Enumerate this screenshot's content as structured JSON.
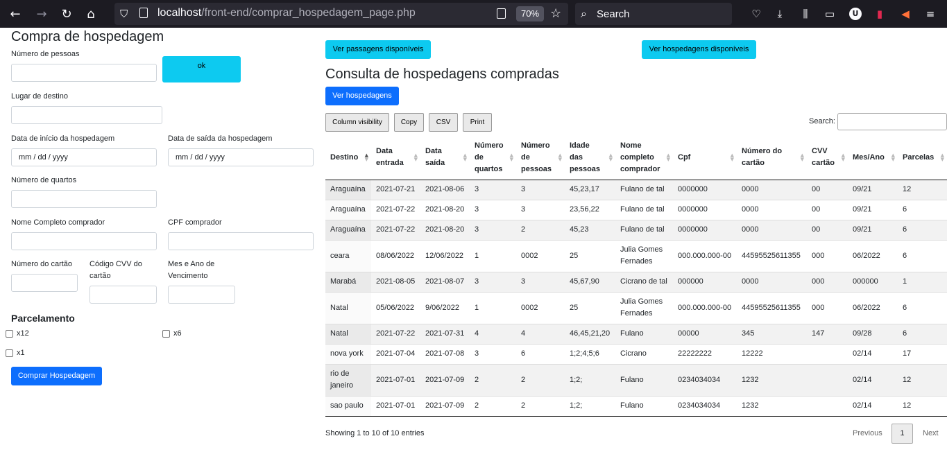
{
  "browser": {
    "url_host": "localhost",
    "url_path": "/front-end/comprar_hospedagem_page.php",
    "zoom": "70%",
    "search_placeholder": "Search",
    "avatar_letter": "U"
  },
  "form": {
    "title": "Compra de hospedagem",
    "num_pessoas_label": "Número de pessoas",
    "ok_label": "ok",
    "destino_label": "Lugar de destino",
    "data_inicio_label": "Data de início da hospedagem",
    "data_inicio_value": "mm / dd / yyyy",
    "data_saida_label": "Data de saída da hospedagem",
    "data_saida_value": "mm / dd / yyyy",
    "num_quartos_label": "Número de quartos",
    "nome_label": "Nome Completo comprador",
    "cpf_label": "CPF comprador",
    "cartao_label": "Número do cartão",
    "cvv_label_1": "Código CVV do",
    "cvv_label_2": "cartão",
    "venc_label_1": "Mes e Ano de",
    "venc_label_2": "Vencimento",
    "parcelamento_title": "Parcelamento",
    "opt_x12": "x12",
    "opt_x6": "x6",
    "opt_x1": "x1",
    "submit_label": "Comprar Hospedagem"
  },
  "right": {
    "ver_passagens": "Ver passagens disponíveis",
    "ver_hospedagens_disp": "Ver hospedagens disponíveis",
    "title": "Consulta de hospedagens compradas",
    "ver_hospedagens": "Ver hospedagens",
    "dt_buttons": [
      "Column visibility",
      "Copy",
      "CSV",
      "Print"
    ],
    "search_label": "Search:",
    "info": "Showing 1 to 10 of 10 entries",
    "prev": "Previous",
    "page": "1",
    "next": "Next"
  },
  "table": {
    "headers": [
      [
        "Destino"
      ],
      [
        "Data",
        "entrada"
      ],
      [
        "Data",
        "saída"
      ],
      [
        "Número",
        "de",
        "quartos"
      ],
      [
        "Número",
        "de",
        "pessoas"
      ],
      [
        "Idade",
        "das",
        "pessoas"
      ],
      [
        "Nome",
        "completo",
        "comprador"
      ],
      [
        "Cpf"
      ],
      [
        "Número do",
        "cartão"
      ],
      [
        "CVV",
        "cartão"
      ],
      [
        "Mes/Ano"
      ],
      [
        "Parcelas"
      ]
    ],
    "rows": [
      [
        [
          "Araguaína"
        ],
        "2021-07-21",
        "2021-08-06",
        "3",
        "3",
        "45,23,17",
        [
          "Fulano de tal"
        ],
        "0000000",
        "0000",
        "00",
        "09/21",
        "12"
      ],
      [
        [
          "Araguaína"
        ],
        "2021-07-22",
        "2021-08-20",
        "3",
        "3",
        "23,56,22",
        [
          "Fulano de tal"
        ],
        "0000000",
        "0000",
        "00",
        "09/21",
        "6"
      ],
      [
        [
          "Araguaína"
        ],
        "2021-07-22",
        "2021-08-20",
        "3",
        "2",
        "45,23",
        [
          "Fulano de tal"
        ],
        "0000000",
        "0000",
        "00",
        "09/21",
        "6"
      ],
      [
        [
          "ceara"
        ],
        "08/06/2022",
        "12/06/2022",
        "1",
        "0002",
        "25",
        [
          "Julia Gomes",
          "Fernades"
        ],
        "000.000.000-00",
        "44595525611355",
        "000",
        "06/2022",
        "6"
      ],
      [
        [
          "Marabá"
        ],
        "2021-08-05",
        "2021-08-07",
        "3",
        "3",
        "45,67,90",
        [
          "Cicrano de tal"
        ],
        "000000",
        "0000",
        "000",
        "000000",
        "1"
      ],
      [
        [
          "Natal"
        ],
        "05/06/2022",
        "9/06/2022",
        "1",
        "0002",
        "25",
        [
          "Julia Gomes",
          "Fernades"
        ],
        "000.000.000-00",
        "44595525611355",
        "000",
        "06/2022",
        "6"
      ],
      [
        [
          "Natal"
        ],
        "2021-07-22",
        "2021-07-31",
        "4",
        "4",
        "46,45,21,20",
        [
          "Fulano"
        ],
        "00000",
        "345",
        "147",
        "09/28",
        "6"
      ],
      [
        [
          "nova york"
        ],
        "2021-07-04",
        "2021-07-08",
        "3",
        "6",
        "1;2;4;5;6",
        [
          "Cicrano"
        ],
        "22222222",
        "12222",
        "",
        "02/14",
        "17"
      ],
      [
        [
          "rio de",
          "janeiro"
        ],
        "2021-07-01",
        "2021-07-09",
        "2",
        "2",
        "1;2;",
        [
          "Fulano"
        ],
        "0234034034",
        "1232",
        "",
        "02/14",
        "12"
      ],
      [
        [
          "sao paulo"
        ],
        "2021-07-01",
        "2021-07-09",
        "2",
        "2",
        "1;2;",
        [
          "Fulano"
        ],
        "0234034034",
        "1232",
        "",
        "02/14",
        "12"
      ]
    ]
  }
}
